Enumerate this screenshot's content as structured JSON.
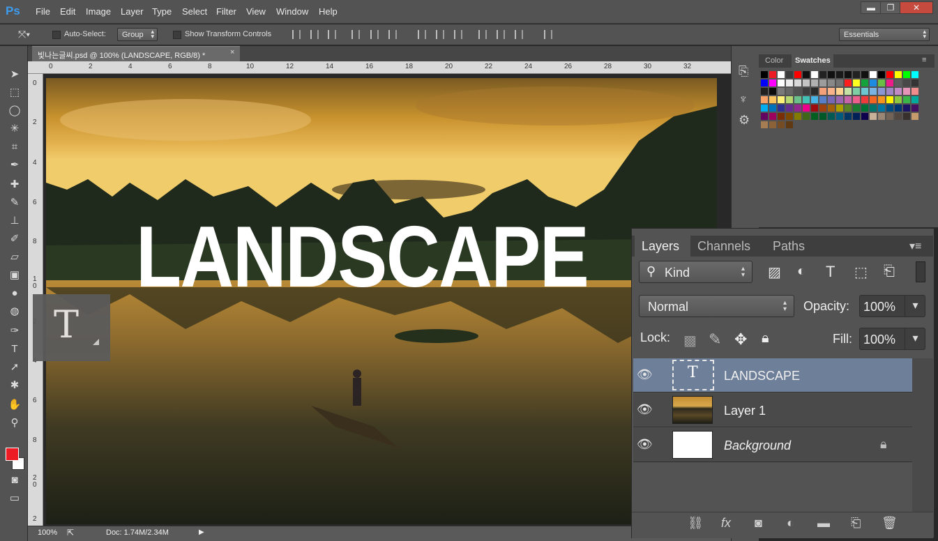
{
  "app": {
    "logo": "Ps"
  },
  "menu": [
    "File",
    "Edit",
    "Image",
    "Layer",
    "Type",
    "Select",
    "Filter",
    "View",
    "Window",
    "Help"
  ],
  "window_controls": {
    "minimize": "▬",
    "restore": "❐",
    "close": "✕"
  },
  "options_bar": {
    "auto_select_label": "Auto-Select:",
    "auto_select_value": "Group",
    "show_transform_label": "Show Transform Controls",
    "workspace": "Essentials"
  },
  "document": {
    "tab_title": "빛나는글씨.psd @ 100% (LANDSCAPE, RGB/8) *",
    "close": "×",
    "ruler_top": [
      "0",
      "2",
      "4",
      "6",
      "8",
      "10",
      "12",
      "14",
      "16",
      "18",
      "20",
      "22",
      "24",
      "26",
      "28",
      "30",
      "32"
    ],
    "ruler_left": [
      "0",
      "2",
      "4",
      "6",
      "8",
      "1\n0",
      "2",
      "4",
      "6",
      "8",
      "2\n0",
      "2"
    ],
    "canvas_text": "LANDSCAPE"
  },
  "status": {
    "zoom": "100%",
    "doc": "Doc: 1.74M/2.34M"
  },
  "tool_overlay": {
    "glyph": "T"
  },
  "swatches_panel": {
    "tabs": [
      "Color",
      "Swatches"
    ],
    "active_tab": "Swatches",
    "colors": [
      "#000000",
      "#ed1c24",
      "#ffffff",
      "#3b3b3b",
      "#ff0000",
      "#111111",
      "#ffffff",
      "#222222",
      "#111111",
      "#1a1a1a",
      "#111111",
      "#222222",
      "#111111",
      "#ffffff",
      "#000000",
      "#ff0000",
      "#ffff00",
      "#00ff00",
      "#00ffff",
      "#0000ff",
      "#ff00ff",
      "#ffffff",
      "#ececec",
      "#d8d8d8",
      "#c4c4c4",
      "#b0b0b0",
      "#9c9c9c",
      "#888888",
      "#747474",
      "#ff1f1f",
      "#ffff1f",
      "#14a33a",
      "#1d8ce0",
      "#6bbe45",
      "#ec1c8b",
      "#5c5c5c",
      "#484848",
      "#343434",
      "#202020",
      "#0c0c0c",
      "#7a7a7a",
      "#666666",
      "#525252",
      "#3e3e3e",
      "#2a2a2a",
      "#f6a07a",
      "#f9b38a",
      "#fbd28f",
      "#c5e1a5",
      "#7fcfa4",
      "#6cc7d1",
      "#7ab4e3",
      "#8a96d1",
      "#9f86c5",
      "#c08ac5",
      "#e694b8",
      "#f08c8c",
      "#f5a167",
      "#f8c35f",
      "#fff079",
      "#b7d871",
      "#6ac08b",
      "#41c2b4",
      "#48b3e5",
      "#5b7ec8",
      "#7768b5",
      "#9a66b2",
      "#c764a9",
      "#ec5f8d",
      "#ef3b3b",
      "#f26522",
      "#f7941d",
      "#fff200",
      "#8dc63f",
      "#39b54a",
      "#00a99d",
      "#00aeef",
      "#0072bc",
      "#2e3192",
      "#662d91",
      "#92278f",
      "#ec008c",
      "#9e0b0f",
      "#a0410d",
      "#a3620a",
      "#aba000",
      "#598527",
      "#197b30",
      "#007236",
      "#00746b",
      "#0076a3",
      "#004a80",
      "#003471",
      "#1b1464",
      "#440e62",
      "#630460",
      "#9e005d",
      "#7b2e00",
      "#7d4900",
      "#827b00",
      "#406618",
      "#005e20",
      "#005826",
      "#005952",
      "#005b7f",
      "#003663",
      "#002157",
      "#0d004c",
      "#c7b299",
      "#998675",
      "#736357",
      "#534741",
      "#37302d",
      "#c69c6d",
      "#a67c52",
      "#8c6239",
      "#754c24",
      "#603913"
    ]
  },
  "layers_panel": {
    "tabs": [
      "Layers",
      "Channels",
      "Paths"
    ],
    "kind_label": "Kind",
    "blend_mode": "Normal",
    "opacity_label": "Opacity:",
    "opacity_value": "100%",
    "lock_label": "Lock:",
    "fill_label": "Fill:",
    "fill_value": "100%",
    "layers": [
      {
        "name": "LANDSCAPE",
        "type": "text",
        "selected": true
      },
      {
        "name": "Layer 1",
        "type": "image",
        "selected": false
      },
      {
        "name": "Background",
        "type": "background",
        "selected": false,
        "locked": true
      }
    ]
  },
  "colors": {
    "foreground": "#ed1c24",
    "background": "#ffffff",
    "selected_layer": "#6e7f99"
  }
}
